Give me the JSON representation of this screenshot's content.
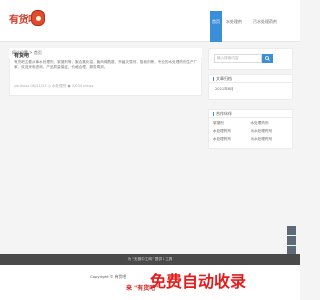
{
  "header": {
    "logo_text": "有货吧",
    "nav": [
      "首页",
      "水处理剂",
      "污水处理药剂"
    ]
  },
  "breadcrumb": "网站位置 > 首页",
  "post": {
    "title": "有货吧",
    "body": "有货吧主要从事水处理剂，絮凝剂等，聚合氯化铝，聚丙烯酰胺，杀菌灭藻剂，阻垢剂等，专业的水处理药剂生产厂家，欢迎来电咨询，产品质量保证，价格合理，服务周到。",
    "meta": "youhuoz 06/21/23 ◎ 水处理剂 ● 2,004 views"
  },
  "sidebar": {
    "search_placeholder": "输入搜索内容",
    "panel1_title": "文章归档",
    "panel1_item": "2021年8月",
    "panel2_title": "合作伙伴",
    "links": [
      "絮凝剂",
      "水处理药剂",
      "水处理药剂",
      "污水处理药剂",
      "水处理药剂",
      "污水处理药剂"
    ]
  },
  "footer": {
    "bar": "为 \"无极中工网\" 提供 ⅰ 工具",
    "copyright": "Copyright © 有货吧",
    "watermark_tag": "来 \"有货吧\"",
    "watermark_big": "免费自动收录"
  },
  "colors": {
    "accent": "#3a8fd8",
    "brand": "#d23b2a",
    "watermark": "#e41c1c"
  }
}
